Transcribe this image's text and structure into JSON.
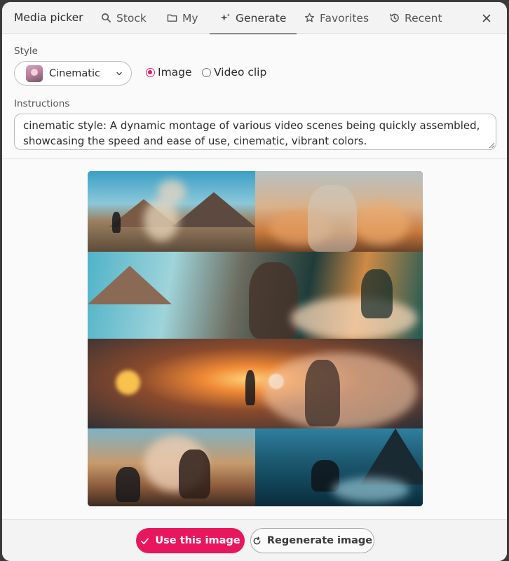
{
  "header": {
    "title": "Media picker",
    "tabs": [
      {
        "label": "Stock",
        "icon": "search-icon"
      },
      {
        "label": "My",
        "icon": "folder-icon"
      },
      {
        "label": "Generate",
        "icon": "sparkle-icon",
        "active": true
      },
      {
        "label": "Favorites",
        "icon": "star-icon"
      },
      {
        "label": "Recent",
        "icon": "history-icon"
      }
    ],
    "close_icon": "close-icon"
  },
  "form": {
    "style_label": "Style",
    "style_value": "Cinematic",
    "media_type_options": [
      {
        "label": "Image",
        "checked": true
      },
      {
        "label": "Video clip",
        "checked": false
      }
    ],
    "instructions_label": "Instructions",
    "instructions_value": "cinematic style: A dynamic montage of various video scenes being quickly assembled, showcasing the speed and ease of use, cinematic, vibrant colors."
  },
  "footer": {
    "use_button": "Use this image",
    "regenerate_button": "Regenerate image"
  },
  "colors": {
    "accent": "#e8175d",
    "header_bg": "#f3f3f3",
    "dialog_bg": "#fafafa"
  }
}
